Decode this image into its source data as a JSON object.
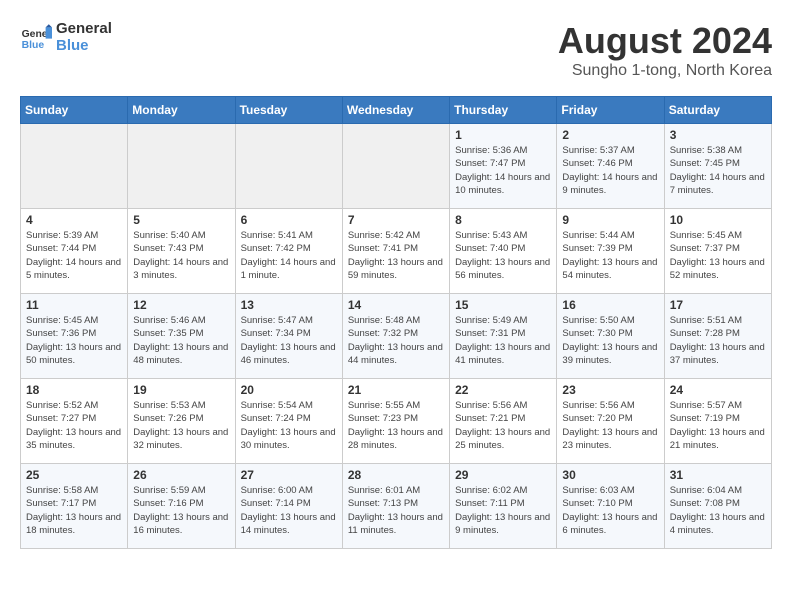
{
  "header": {
    "logo_general": "General",
    "logo_blue": "Blue",
    "month_year": "August 2024",
    "location": "Sungho 1-tong, North Korea"
  },
  "calendar": {
    "weekdays": [
      "Sunday",
      "Monday",
      "Tuesday",
      "Wednesday",
      "Thursday",
      "Friday",
      "Saturday"
    ],
    "weeks": [
      [
        {
          "day": "",
          "empty": true
        },
        {
          "day": "",
          "empty": true
        },
        {
          "day": "",
          "empty": true
        },
        {
          "day": "",
          "empty": true
        },
        {
          "day": "1",
          "sunrise": "Sunrise: 5:36 AM",
          "sunset": "Sunset: 7:47 PM",
          "daylight": "Daylight: 14 hours and 10 minutes."
        },
        {
          "day": "2",
          "sunrise": "Sunrise: 5:37 AM",
          "sunset": "Sunset: 7:46 PM",
          "daylight": "Daylight: 14 hours and 9 minutes."
        },
        {
          "day": "3",
          "sunrise": "Sunrise: 5:38 AM",
          "sunset": "Sunset: 7:45 PM",
          "daylight": "Daylight: 14 hours and 7 minutes."
        }
      ],
      [
        {
          "day": "4",
          "sunrise": "Sunrise: 5:39 AM",
          "sunset": "Sunset: 7:44 PM",
          "daylight": "Daylight: 14 hours and 5 minutes."
        },
        {
          "day": "5",
          "sunrise": "Sunrise: 5:40 AM",
          "sunset": "Sunset: 7:43 PM",
          "daylight": "Daylight: 14 hours and 3 minutes."
        },
        {
          "day": "6",
          "sunrise": "Sunrise: 5:41 AM",
          "sunset": "Sunset: 7:42 PM",
          "daylight": "Daylight: 14 hours and 1 minute."
        },
        {
          "day": "7",
          "sunrise": "Sunrise: 5:42 AM",
          "sunset": "Sunset: 7:41 PM",
          "daylight": "Daylight: 13 hours and 59 minutes."
        },
        {
          "day": "8",
          "sunrise": "Sunrise: 5:43 AM",
          "sunset": "Sunset: 7:40 PM",
          "daylight": "Daylight: 13 hours and 56 minutes."
        },
        {
          "day": "9",
          "sunrise": "Sunrise: 5:44 AM",
          "sunset": "Sunset: 7:39 PM",
          "daylight": "Daylight: 13 hours and 54 minutes."
        },
        {
          "day": "10",
          "sunrise": "Sunrise: 5:45 AM",
          "sunset": "Sunset: 7:37 PM",
          "daylight": "Daylight: 13 hours and 52 minutes."
        }
      ],
      [
        {
          "day": "11",
          "sunrise": "Sunrise: 5:45 AM",
          "sunset": "Sunset: 7:36 PM",
          "daylight": "Daylight: 13 hours and 50 minutes."
        },
        {
          "day": "12",
          "sunrise": "Sunrise: 5:46 AM",
          "sunset": "Sunset: 7:35 PM",
          "daylight": "Daylight: 13 hours and 48 minutes."
        },
        {
          "day": "13",
          "sunrise": "Sunrise: 5:47 AM",
          "sunset": "Sunset: 7:34 PM",
          "daylight": "Daylight: 13 hours and 46 minutes."
        },
        {
          "day": "14",
          "sunrise": "Sunrise: 5:48 AM",
          "sunset": "Sunset: 7:32 PM",
          "daylight": "Daylight: 13 hours and 44 minutes."
        },
        {
          "day": "15",
          "sunrise": "Sunrise: 5:49 AM",
          "sunset": "Sunset: 7:31 PM",
          "daylight": "Daylight: 13 hours and 41 minutes."
        },
        {
          "day": "16",
          "sunrise": "Sunrise: 5:50 AM",
          "sunset": "Sunset: 7:30 PM",
          "daylight": "Daylight: 13 hours and 39 minutes."
        },
        {
          "day": "17",
          "sunrise": "Sunrise: 5:51 AM",
          "sunset": "Sunset: 7:28 PM",
          "daylight": "Daylight: 13 hours and 37 minutes."
        }
      ],
      [
        {
          "day": "18",
          "sunrise": "Sunrise: 5:52 AM",
          "sunset": "Sunset: 7:27 PM",
          "daylight": "Daylight: 13 hours and 35 minutes."
        },
        {
          "day": "19",
          "sunrise": "Sunrise: 5:53 AM",
          "sunset": "Sunset: 7:26 PM",
          "daylight": "Daylight: 13 hours and 32 minutes."
        },
        {
          "day": "20",
          "sunrise": "Sunrise: 5:54 AM",
          "sunset": "Sunset: 7:24 PM",
          "daylight": "Daylight: 13 hours and 30 minutes."
        },
        {
          "day": "21",
          "sunrise": "Sunrise: 5:55 AM",
          "sunset": "Sunset: 7:23 PM",
          "daylight": "Daylight: 13 hours and 28 minutes."
        },
        {
          "day": "22",
          "sunrise": "Sunrise: 5:56 AM",
          "sunset": "Sunset: 7:21 PM",
          "daylight": "Daylight: 13 hours and 25 minutes."
        },
        {
          "day": "23",
          "sunrise": "Sunrise: 5:56 AM",
          "sunset": "Sunset: 7:20 PM",
          "daylight": "Daylight: 13 hours and 23 minutes."
        },
        {
          "day": "24",
          "sunrise": "Sunrise: 5:57 AM",
          "sunset": "Sunset: 7:19 PM",
          "daylight": "Daylight: 13 hours and 21 minutes."
        }
      ],
      [
        {
          "day": "25",
          "sunrise": "Sunrise: 5:58 AM",
          "sunset": "Sunset: 7:17 PM",
          "daylight": "Daylight: 13 hours and 18 minutes."
        },
        {
          "day": "26",
          "sunrise": "Sunrise: 5:59 AM",
          "sunset": "Sunset: 7:16 PM",
          "daylight": "Daylight: 13 hours and 16 minutes."
        },
        {
          "day": "27",
          "sunrise": "Sunrise: 6:00 AM",
          "sunset": "Sunset: 7:14 PM",
          "daylight": "Daylight: 13 hours and 14 minutes."
        },
        {
          "day": "28",
          "sunrise": "Sunrise: 6:01 AM",
          "sunset": "Sunset: 7:13 PM",
          "daylight": "Daylight: 13 hours and 11 minutes."
        },
        {
          "day": "29",
          "sunrise": "Sunrise: 6:02 AM",
          "sunset": "Sunset: 7:11 PM",
          "daylight": "Daylight: 13 hours and 9 minutes."
        },
        {
          "day": "30",
          "sunrise": "Sunrise: 6:03 AM",
          "sunset": "Sunset: 7:10 PM",
          "daylight": "Daylight: 13 hours and 6 minutes."
        },
        {
          "day": "31",
          "sunrise": "Sunrise: 6:04 AM",
          "sunset": "Sunset: 7:08 PM",
          "daylight": "Daylight: 13 hours and 4 minutes."
        }
      ]
    ]
  }
}
